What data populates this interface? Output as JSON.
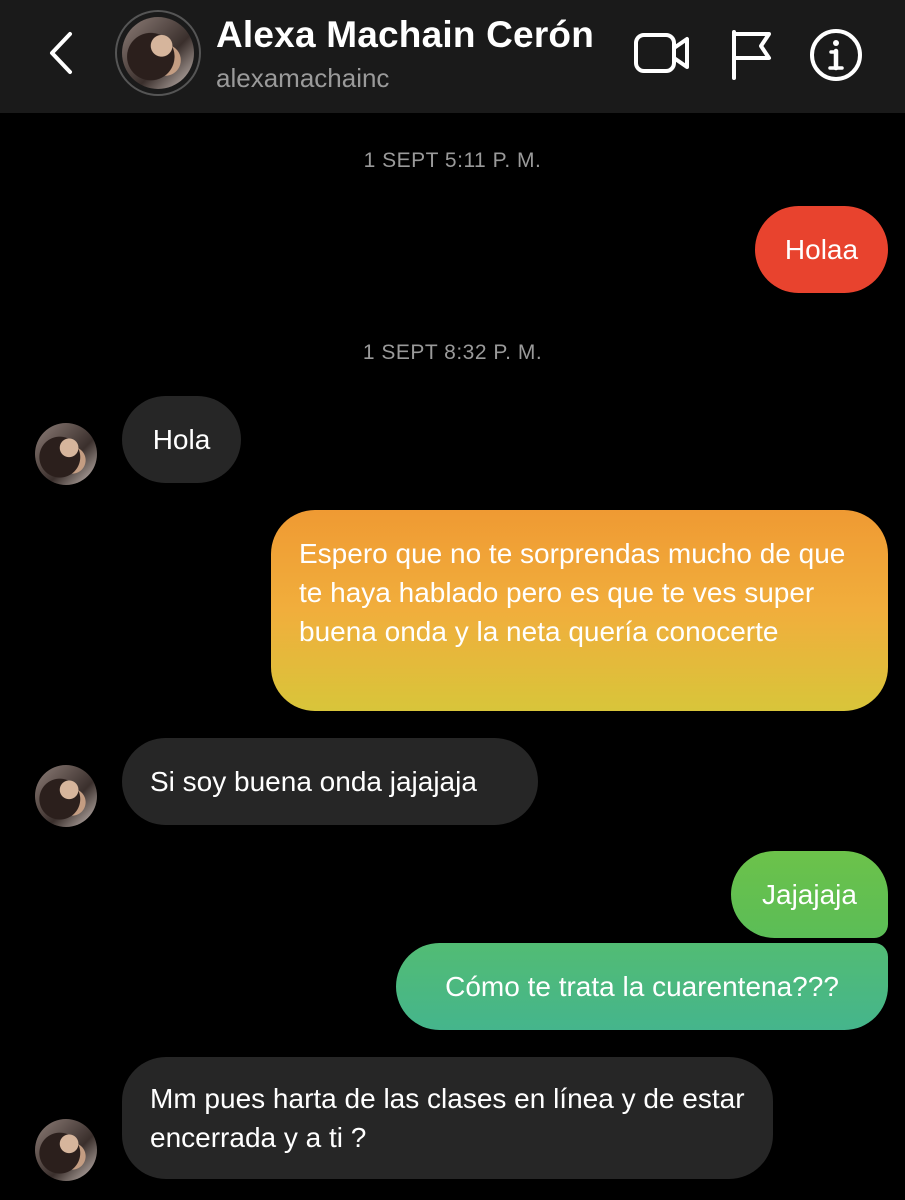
{
  "header": {
    "name": "Alexa Machain Cerón",
    "handle": "alexamachainc",
    "icons": [
      "back-icon",
      "video-call-icon",
      "flag-icon",
      "info-icon"
    ]
  },
  "timestamps": [
    "1 SEPT 5:11 P. M.",
    "1 SEPT 8:32 P. M."
  ],
  "messages": [
    {
      "from": "me",
      "text": "Holaa"
    },
    {
      "from": "them",
      "text": "Hola"
    },
    {
      "from": "me",
      "text": "Espero que no te sorprendas mucho de que te haya hablado pero es que te ves super buena onda y la neta quería conocerte"
    },
    {
      "from": "them",
      "text": "Si soy buena onda jajajaja"
    },
    {
      "from": "me",
      "text": "Jajajaja"
    },
    {
      "from": "me",
      "text": "Cómo te trata la cuarentena???"
    },
    {
      "from": "them",
      "text": "Mm pues harta de las clases en línea y de estar encerrada y a ti ?"
    }
  ],
  "colors": {
    "header_bg": "#1a1a1a",
    "incoming_bubble": "#262626",
    "outgoing_top": "#e8432e",
    "outgoing_mid": "#f0a63a",
    "outgoing_bottom": "#45b58c"
  }
}
